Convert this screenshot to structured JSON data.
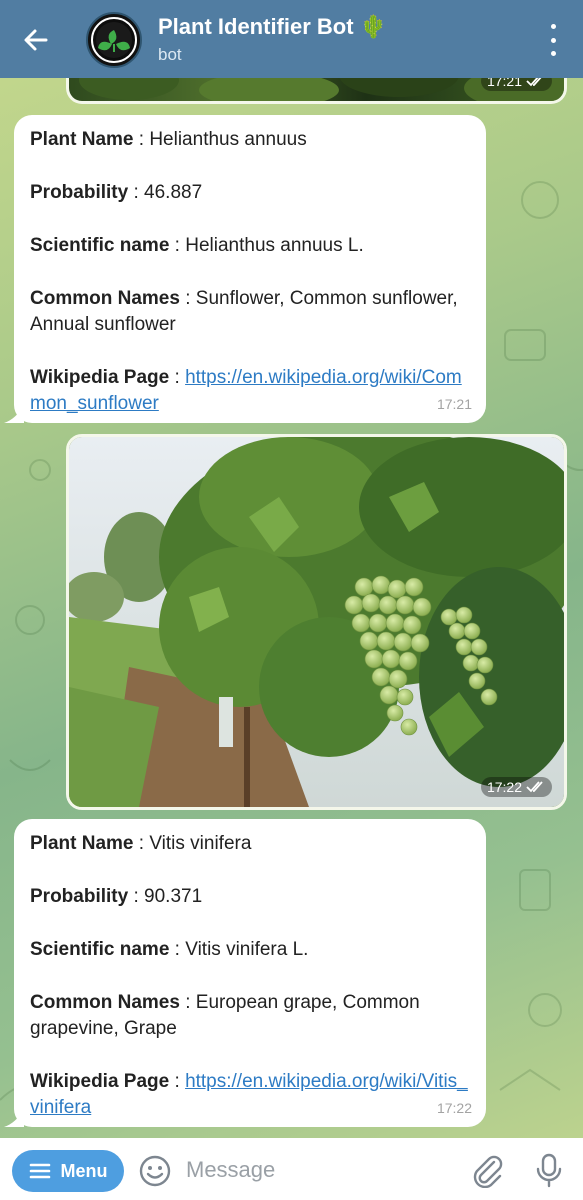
{
  "header": {
    "title": "Plant Identifier Bot 🌵",
    "subtitle": "bot"
  },
  "top_photo": {
    "time": "17:21"
  },
  "messages": [
    {
      "plant_name_label": "Plant Name",
      "plant_name": "Helianthus annuus",
      "probability_label": "Probability",
      "probability": "46.887",
      "scientific_label": "Scientific name",
      "scientific": "Helianthus annuus L.",
      "common_label": "Common Names",
      "common": "Sunflower, Common sunflower, Annual sunflower",
      "wiki_label": "Wikipedia Page",
      "wiki_url": "https://en.wikipedia.org/wiki/Common_sunflower",
      "time": "17:21"
    },
    {
      "plant_name_label": "Plant Name",
      "plant_name": "Vitis vinifera",
      "probability_label": "Probability",
      "probability": "90.371",
      "scientific_label": "Scientific name",
      "scientific": "Vitis vinifera L.",
      "common_label": "Common Names",
      "common": "European grape, Common grapevine, Grape",
      "wiki_label": "Wikipedia Page",
      "wiki_url": "https://en.wikipedia.org/wiki/Vitis_vinifera",
      "time": "17:22"
    }
  ],
  "grape_photo": {
    "time": "17:22"
  },
  "input_bar": {
    "menu_label": "Menu",
    "placeholder": "Message"
  },
  "colors": {
    "header_bg": "#517da2",
    "link": "#2d7bc4",
    "menu_button": "#4e9ee0"
  }
}
